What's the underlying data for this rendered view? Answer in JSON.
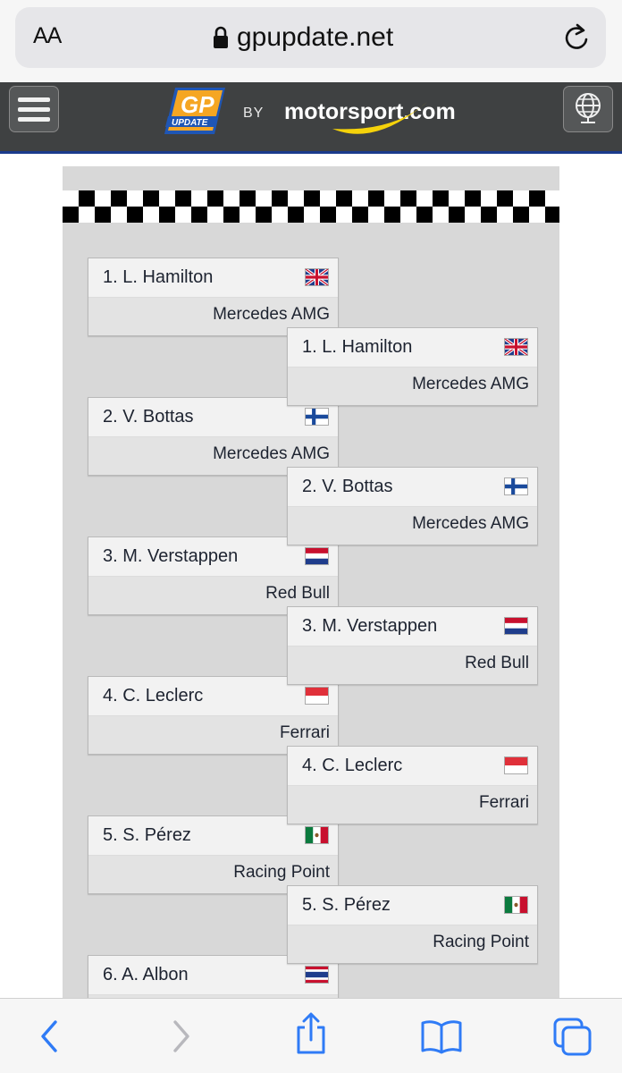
{
  "browser": {
    "text_size_label": "AA",
    "url": "gpupdate.net"
  },
  "header": {
    "gp_logo_text": "GP UPDATE",
    "by_label": "BY",
    "partner": "motorsport.com"
  },
  "bracket": {
    "left_column": [
      {
        "driver": "1. L. Hamilton",
        "team": "Mercedes AMG",
        "flag": "uk"
      },
      {
        "driver": "2. V. Bottas",
        "team": "Mercedes AMG",
        "flag": "finland"
      },
      {
        "driver": "3. M. Verstappen",
        "team": "Red Bull",
        "flag": "netherlands"
      },
      {
        "driver": "4. C. Leclerc",
        "team": "Ferrari",
        "flag": "monaco"
      },
      {
        "driver": "5. S. Pérez",
        "team": "Racing Point",
        "flag": "mexico"
      },
      {
        "driver": "6. A. Albon",
        "team": "",
        "flag": "thailand"
      }
    ],
    "right_column": [
      {
        "driver": "1. L. Hamilton",
        "team": "Mercedes AMG",
        "flag": "uk"
      },
      {
        "driver": "2. V. Bottas",
        "team": "Mercedes AMG",
        "flag": "finland"
      },
      {
        "driver": "3. M. Verstappen",
        "team": "Red Bull",
        "flag": "netherlands"
      },
      {
        "driver": "4. C. Leclerc",
        "team": "Ferrari",
        "flag": "monaco"
      },
      {
        "driver": "5. S. Pérez",
        "team": "Racing Point",
        "flag": "mexico"
      }
    ]
  },
  "colors": {
    "header_bg": "#3f4142",
    "accent_blue": "#1a3a8c",
    "toolbar_icon": "#2f7bf6",
    "panel_bg": "#d8d8d8"
  }
}
